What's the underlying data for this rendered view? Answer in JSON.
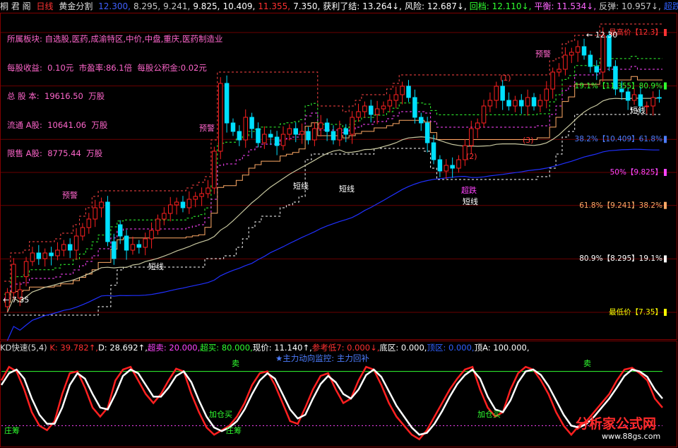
{
  "header": {
    "stock_name": "桐 君 阁",
    "period": "日线",
    "indicator_name": "黄金分割",
    "values": [
      {
        "text": "12.300,",
        "color": "#4060ff"
      },
      {
        "text": "8.295,",
        "color": "#c8c8c8"
      },
      {
        "text": "9.241,",
        "color": "#c8c8c8"
      },
      {
        "text": "9.825,",
        "color": "#ffffff"
      },
      {
        "text": "10.409,",
        "color": "#ffffff"
      },
      {
        "text": "11.355,",
        "color": "#ff3030"
      },
      {
        "text": "7.350,",
        "color": "#ffffff"
      },
      {
        "text": "获利了结: 13.264↓,",
        "color": "#ffffff"
      },
      {
        "text": "风险: 12.687↓,",
        "color": "#ffffff"
      },
      {
        "text": "回档: 12.110↓,",
        "color": "#30ff30"
      },
      {
        "text": "平衡: 11.534↓,",
        "color": "#ff66ff"
      },
      {
        "text": "反弹: 10.957↓,",
        "color": "#c8c8c8"
      },
      {
        "text": "超跌: 10.38",
        "color": "#3060ff"
      }
    ]
  },
  "info_panel": {
    "lines": [
      "所属板块: 自选股,医药,成渝特区,中价,中盘,重庆,医药制造业",
      "每股收益:  0.10元  市盈率:86.1倍  每股公积金:0.02元",
      "总 股 本:  19616.50  万股",
      "流通 A股:  10641.06  万股",
      "限售 A股:  8775.44  万股"
    ]
  },
  "price_levels": [
    {
      "label": "最高价【12.3】",
      "value": 12.3,
      "color": "#ff3333"
    },
    {
      "label": "19.1%【11.355】80.9%",
      "value": 11.355,
      "color": "#30ff30"
    },
    {
      "label": "38.2%【10.409】61.8%",
      "value": 10.409,
      "color": "#4d7dff"
    },
    {
      "label": "50%【9.825】",
      "value": 9.825,
      "color": "#ff44ff"
    },
    {
      "label": "61.8%【9.241】38.2%",
      "value": 9.241,
      "color": "#ffaa66"
    },
    {
      "label": "80.9%【8.295】19.1%",
      "value": 8.295,
      "color": "#ffffff"
    },
    {
      "label": "最低价【7.35】",
      "value": 7.35,
      "color": "#ffff00"
    }
  ],
  "annotations": {
    "high_marker": "12.30",
    "low_marker": "7.35",
    "warning": "预警",
    "short_line": "短线",
    "oversold": "超跌",
    "numbers": [
      "(1)",
      "(2)",
      "(3)"
    ]
  },
  "kd_header": {
    "title": "KD快速(5,4)",
    "items": [
      {
        "text": "K: 39.782↑,",
        "color": "#ff3030"
      },
      {
        "text": "D: 28.692↑,",
        "color": "#ffffff"
      },
      {
        "text": "超卖: 20.000,",
        "color": "#ff44ff"
      },
      {
        "text": "超买: 80.000,",
        "color": "#30ff30"
      },
      {
        "text": "现价: 11.140↑,",
        "color": "#ffffff"
      },
      {
        "text": "参考低7: 0.000↓,",
        "color": "#ff3030"
      },
      {
        "text": "底区: 0.000,",
        "color": "#ffffff"
      },
      {
        "text": "顶区: 0.000,",
        "color": "#3060ff"
      },
      {
        "text": "顶A: 100.000,",
        "color": "#ffffff"
      }
    ]
  },
  "kd_annotations": {
    "monitor": "★主力动向监控: 主力回补",
    "sell": "卖",
    "add_position": "加仓买",
    "accumulate": "庄筹"
  },
  "watermark": {
    "brand": "分析家公式网",
    "site": "www.88gs.com"
  },
  "chart_data": [
    {
      "type": "candlestick",
      "title": "桐君阁 日线 黄金分割",
      "ylim": [
        6.9,
        12.6
      ],
      "x": [
        1,
        2,
        3,
        4,
        5,
        6,
        7,
        8,
        9,
        10,
        11,
        12,
        13,
        14,
        15,
        16,
        17,
        18,
        19,
        20,
        21,
        22,
        23,
        24,
        25,
        26,
        27,
        28,
        29,
        30,
        31,
        32,
        33,
        34,
        35,
        36,
        37,
        38,
        39,
        40,
        41,
        42,
        43,
        44,
        45,
        46,
        47,
        48,
        49,
        50,
        51,
        52,
        53,
        54,
        55,
        56,
        57,
        58,
        59,
        60,
        61,
        62,
        63,
        64,
        65,
        66,
        67,
        68,
        69,
        70,
        71,
        72,
        73,
        74,
        75,
        76,
        77,
        78,
        79,
        80,
        81,
        82,
        83,
        84,
        85,
        86,
        87,
        88,
        89,
        90,
        91,
        92,
        93,
        94,
        95,
        96,
        97,
        98,
        99,
        100,
        101,
        102,
        103,
        104,
        105,
        106,
        107,
        108,
        109,
        110,
        111,
        112,
        113,
        114,
        115,
        116,
        117,
        118,
        119,
        120,
        121,
        122,
        123,
        124,
        125,
        126,
        127,
        128,
        129,
        130,
        131,
        132,
        133,
        134,
        135,
        136,
        137,
        138,
        139,
        140,
        141,
        142,
        143,
        144,
        145,
        146,
        147,
        148,
        149,
        150,
        151,
        152,
        153,
        154,
        155
      ],
      "open": [
        7.45,
        7.7,
        7.6,
        7.98,
        8.25,
        8.4,
        8.3,
        8.4,
        8.35,
        8.45,
        8.55,
        8.45,
        8.7,
        8.85,
        9.0,
        9.2,
        9.3,
        8.6,
        8.9,
        8.7,
        8.45,
        8.55,
        8.5,
        8.65,
        8.8,
        9.0,
        9.1,
        9.25,
        9.3,
        9.2,
        9.35,
        9.4,
        9.45,
        9.55,
        10.2,
        11.4,
        10.7,
        10.55,
        10.4,
        10.8,
        10.6,
        10.35,
        10.5,
        10.45,
        10.3,
        10.5,
        10.6,
        10.5,
        10.55,
        10.4,
        10.6,
        10.7,
        10.55,
        10.4,
        10.6,
        10.5,
        10.8,
        10.9,
        11.0,
        10.85,
        10.95,
        11.0,
        11.1,
        11.2,
        11.35,
        11.15,
        10.8,
        10.7,
        10.35,
        10.05,
        9.85,
        9.95,
        9.9,
        10.05,
        10.3,
        10.6,
        10.7,
        11.0,
        11.1,
        11.35,
        11.1,
        11.0,
        11.1,
        11.0,
        11.15,
        11.0,
        11.1,
        11.3,
        11.6,
        11.65,
        11.9,
        11.95,
        12.05,
        11.9,
        11.7,
        11.6,
        12.25,
        11.7,
        11.3,
        11.25,
        11.1,
        11.2,
        11.0,
        11.0,
        11.15
      ],
      "close": [
        7.7,
        8.2,
        7.75,
        8.25,
        8.4,
        8.3,
        8.4,
        8.35,
        8.45,
        8.55,
        8.45,
        8.7,
        8.85,
        9.0,
        9.2,
        9.3,
        8.6,
        8.3,
        8.7,
        8.45,
        8.55,
        8.5,
        8.65,
        8.8,
        9.0,
        9.1,
        9.25,
        9.3,
        9.2,
        9.35,
        9.4,
        9.45,
        9.55,
        10.2,
        11.4,
        10.7,
        10.55,
        10.4,
        10.8,
        10.6,
        10.35,
        10.5,
        10.45,
        10.3,
        10.5,
        10.6,
        10.5,
        10.55,
        10.4,
        10.6,
        10.7,
        10.55,
        10.4,
        10.6,
        10.5,
        10.8,
        10.9,
        11.0,
        10.85,
        10.95,
        11.0,
        11.1,
        11.2,
        11.35,
        11.15,
        10.8,
        10.7,
        10.35,
        10.05,
        9.85,
        9.95,
        9.9,
        10.05,
        10.3,
        10.6,
        10.7,
        11.0,
        11.1,
        11.35,
        11.1,
        11.0,
        11.1,
        11.0,
        11.15,
        11.0,
        11.1,
        11.3,
        11.6,
        11.65,
        11.9,
        11.95,
        12.05,
        11.9,
        11.7,
        11.6,
        12.25,
        11.7,
        11.3,
        11.25,
        11.1,
        11.2,
        11.0,
        11.0,
        11.15,
        11.14
      ]
    },
    {
      "type": "line",
      "title": "KD快速(5,4)",
      "ylim": [
        0,
        100
      ],
      "series": [
        {
          "name": "K",
          "color": "#ff2020",
          "values": [
            70,
            85,
            80,
            60,
            35,
            20,
            15,
            25,
            55,
            78,
            80,
            62,
            40,
            30,
            40,
            70,
            82,
            85,
            70,
            55,
            45,
            55,
            70,
            83,
            80,
            55,
            35,
            18,
            10,
            15,
            20,
            30,
            45,
            65,
            78,
            80,
            65,
            45,
            25,
            22,
            40,
            60,
            75,
            78,
            60,
            45,
            50,
            70,
            85,
            82,
            65,
            45,
            30,
            20,
            10,
            5,
            15,
            30,
            45,
            60,
            72,
            82,
            85,
            60,
            40,
            30,
            35,
            60,
            78,
            85,
            82,
            70,
            55,
            35,
            20,
            10,
            20,
            25,
            35,
            45,
            55,
            70,
            82,
            84,
            78,
            70,
            50,
            40
          ]
        },
        {
          "name": "D",
          "color": "#ffffff",
          "values": [
            65,
            78,
            82,
            72,
            50,
            32,
            22,
            22,
            40,
            65,
            78,
            72,
            55,
            40,
            38,
            55,
            75,
            82,
            78,
            65,
            52,
            52,
            62,
            75,
            80,
            68,
            48,
            30,
            18,
            14,
            18,
            25,
            38,
            55,
            70,
            78,
            72,
            55,
            38,
            28,
            32,
            50,
            66,
            75,
            68,
            55,
            50,
            60,
            76,
            82,
            74,
            58,
            42,
            30,
            18,
            10,
            12,
            22,
            36,
            52,
            66,
            76,
            82,
            72,
            52,
            38,
            35,
            48,
            68,
            80,
            82,
            76,
            64,
            48,
            32,
            20,
            18,
            22,
            30,
            40,
            50,
            62,
            75,
            82,
            80,
            74,
            60,
            50
          ]
        }
      ],
      "lines": [
        20,
        80
      ]
    }
  ]
}
